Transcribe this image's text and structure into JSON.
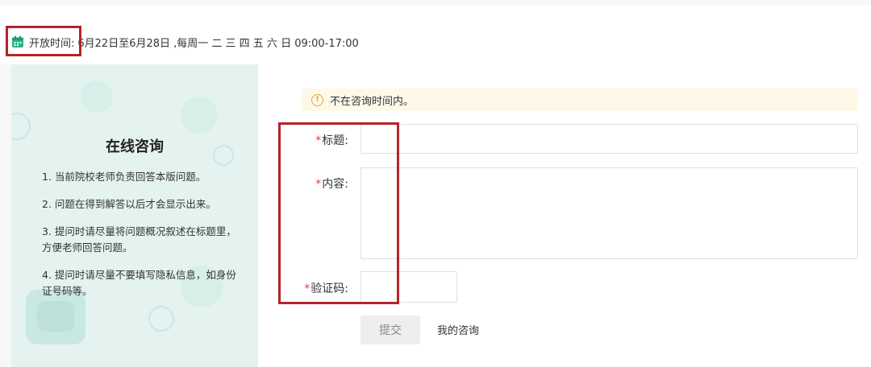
{
  "open_time": {
    "label": "开放时间:",
    "value": "6月22日至6月28日 ,每周一 二 三 四 五 六 日 09:00-17:00",
    "icon": "calendar-icon"
  },
  "left_panel": {
    "title": "在线咨询",
    "tips": [
      "1. 当前院校老师负责回答本版问题。",
      "2. 问题在得到解答以后才会显示出来。",
      "3. 提问时请尽量将问题概况叙述在标题里，方便老师回答问题。",
      "4. 提问时请尽量不要填写隐私信息，如身份证号码等。"
    ]
  },
  "notice": {
    "text": "不在咨询时间内。",
    "icon": "warning-icon"
  },
  "form": {
    "required_mark": "*",
    "title_label": "标题:",
    "content_label": "内容:",
    "captcha_label": "验证码:",
    "title_value": "",
    "content_value": "",
    "captcha_value": ""
  },
  "actions": {
    "submit_label": "提交",
    "my_consult_label": "我的咨询"
  },
  "colors": {
    "accent_green": "#2bb38a",
    "highlight_red": "#b3242a",
    "notice_bg": "#fdf8e8",
    "required_red": "#e4393c"
  }
}
